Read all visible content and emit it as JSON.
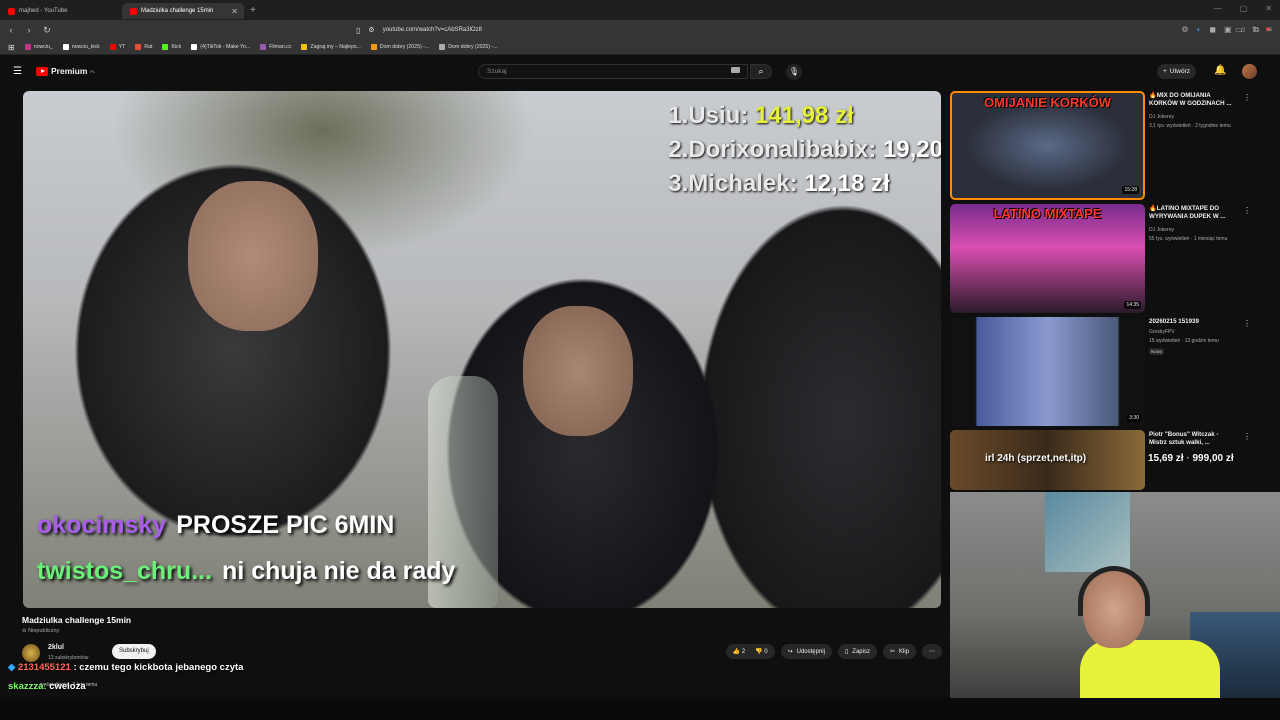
{
  "browser": {
    "tabs": [
      {
        "label": "majhed - YouTube"
      },
      {
        "label": "Madziulka challenge 15min"
      }
    ],
    "url": "youtube.com/watch?v=cAbSRa3lOz8",
    "bookmarks": [
      {
        "label": "nowciu_",
        "color": "#c13584"
      },
      {
        "label": "nowciu_kick",
        "color": "#ffffff"
      },
      {
        "label": "YT",
        "color": "#ff0000"
      },
      {
        "label": "Rat",
        "color": "#e74c3c"
      },
      {
        "label": "Kick",
        "color": "#53fc18"
      },
      {
        "label": "(4)TikTok - Make Yo...",
        "color": "#ffffff"
      },
      {
        "label": "Filman.cc",
        "color": "#9b59b6"
      },
      {
        "label": "Zagraj.my – Najleps...",
        "color": "#f1c40f"
      },
      {
        "label": "Dom dobry (2025) -...",
        "color": "#f39c12"
      },
      {
        "label": "Dom dobry (2025) -...",
        "color": "#aaaaaa"
      }
    ]
  },
  "header": {
    "logo_text": "Premium",
    "logo_region": "PL",
    "search_placeholder": "Szukaj",
    "create_label": "Utwórz"
  },
  "video": {
    "leaderboard": [
      {
        "rank_name": "1.Usiu:",
        "value": "141,98 zł"
      },
      {
        "rank_name": "2.Dorixonalibabix:",
        "value": "19,20"
      },
      {
        "rank_name": "3.Michalek:",
        "value": "12,18 zł"
      }
    ],
    "chat": [
      {
        "user": "okocimsky",
        "message": "PROSZE PIC 6MIN"
      },
      {
        "user": "twistos_chru...",
        "message": "ni chuja nie da rady"
      }
    ],
    "title": "Madziulka challenge 15min",
    "visibility": "Niepubliczny"
  },
  "channel": {
    "name": "2klul",
    "subscribers": "13 subskrybentów",
    "subscribe_label": "Subskrybuj"
  },
  "actions": {
    "likes": "2",
    "dislikes": "0",
    "share": "Udostępnij",
    "save": "Zapisz",
    "clip": "Klip"
  },
  "stream_overlay": {
    "comment1_user": "2131455121",
    "comment1_text": ": czemu tego kickbota jebanego czyta",
    "comment2_user": "skazzza:",
    "comment2_text": "cweloza",
    "views_meta": "wyświetlenia · 2 lata temu",
    "irl_label": "irl 24h (sprzet,net,itp)",
    "donation_current": "15,69 zł",
    "donation_goal": "999,00 zł"
  },
  "recommendations": [
    {
      "title": "🔥MIX DO OMIJANIA KORKÓW W GODZINACH ...",
      "channel": "DJ Jokerey",
      "meta": "3,1 tys. wyświetleń · 2 tygodnie temu",
      "duration": "15:28",
      "thumb_text": "OMIJANIE KORKÓW",
      "new": ""
    },
    {
      "title": "🔥LATINO MIXTAPE DO WYRYWANIA DUPEK W ...",
      "channel": "DJ Jokerey",
      "meta": "55 tys. wyświetleń · 1 miesiąc temu",
      "duration": "14:35",
      "thumb_text": "LATINO MIXTAPE",
      "new": ""
    },
    {
      "title": "20260215 151939",
      "channel": "GorskyFPV",
      "meta": "15 wyświetleń · 13 godzin temu",
      "duration": "3:30",
      "thumb_text": "",
      "new": "Nowy"
    },
    {
      "title": "Piotr \"Bonus\" Witczak - Mistrz sztuk walki, ...",
      "channel": "",
      "meta": "",
      "duration": "",
      "thumb_text": "",
      "new": ""
    }
  ]
}
